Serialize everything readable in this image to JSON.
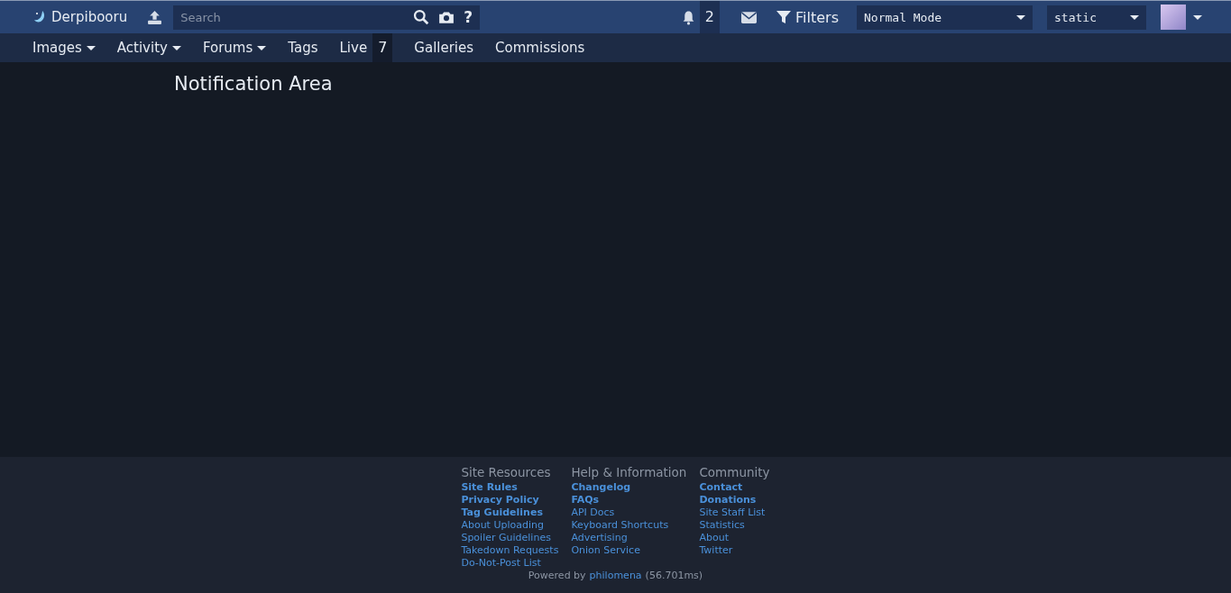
{
  "header": {
    "site_name": "Derpibooru",
    "search": {
      "placeholder": "Search"
    },
    "help": "?",
    "notifications": {
      "count": "2"
    },
    "filters_label": "Filters",
    "filter_select": "Normal Mode",
    "style_select": "static"
  },
  "nav": [
    {
      "label": "Images",
      "dropdown": true
    },
    {
      "label": "Activity",
      "dropdown": true
    },
    {
      "label": "Forums",
      "dropdown": true
    },
    {
      "label": "Tags",
      "dropdown": false
    },
    {
      "label": "Live",
      "dropdown": false,
      "count": "7"
    },
    {
      "label": "Galleries",
      "dropdown": false
    },
    {
      "label": "Commissions",
      "dropdown": false
    }
  ],
  "page_title": "Notification Area",
  "footer": {
    "columns": [
      {
        "heading": "Site Resources",
        "links": [
          {
            "label": "Site Rules",
            "kind": "featured"
          },
          {
            "label": "Privacy Policy",
            "kind": "featured"
          },
          {
            "label": "Tag Guidelines",
            "kind": "featured"
          },
          {
            "label": "About Uploading",
            "kind": "plain"
          },
          {
            "label": "Spoiler Guidelines",
            "kind": "plain"
          },
          {
            "label": "Takedown Requests",
            "kind": "plain"
          },
          {
            "label": "Do-Not-Post List",
            "kind": "plain"
          }
        ]
      },
      {
        "heading": "Help & Information",
        "links": [
          {
            "label": "Changelog",
            "kind": "featured"
          },
          {
            "label": "FAQs",
            "kind": "featured"
          },
          {
            "label": "API Docs",
            "kind": "plain"
          },
          {
            "label": "Keyboard Shortcuts",
            "kind": "plain"
          },
          {
            "label": "Advertising",
            "kind": "plain"
          },
          {
            "label": "Onion Service",
            "kind": "plain"
          }
        ]
      },
      {
        "heading": "Community",
        "links": [
          {
            "label": "Contact",
            "kind": "featured"
          },
          {
            "label": "Donations",
            "kind": "featured"
          },
          {
            "label": "Site Staff List",
            "kind": "plain"
          },
          {
            "label": "Statistics",
            "kind": "plain"
          },
          {
            "label": "About",
            "kind": "plain"
          },
          {
            "label": "Twitter",
            "kind": "plain"
          }
        ]
      }
    ],
    "powered_prefix": "Powered by",
    "powered_link": "philomena",
    "powered_time": "(56.701ms)"
  }
}
